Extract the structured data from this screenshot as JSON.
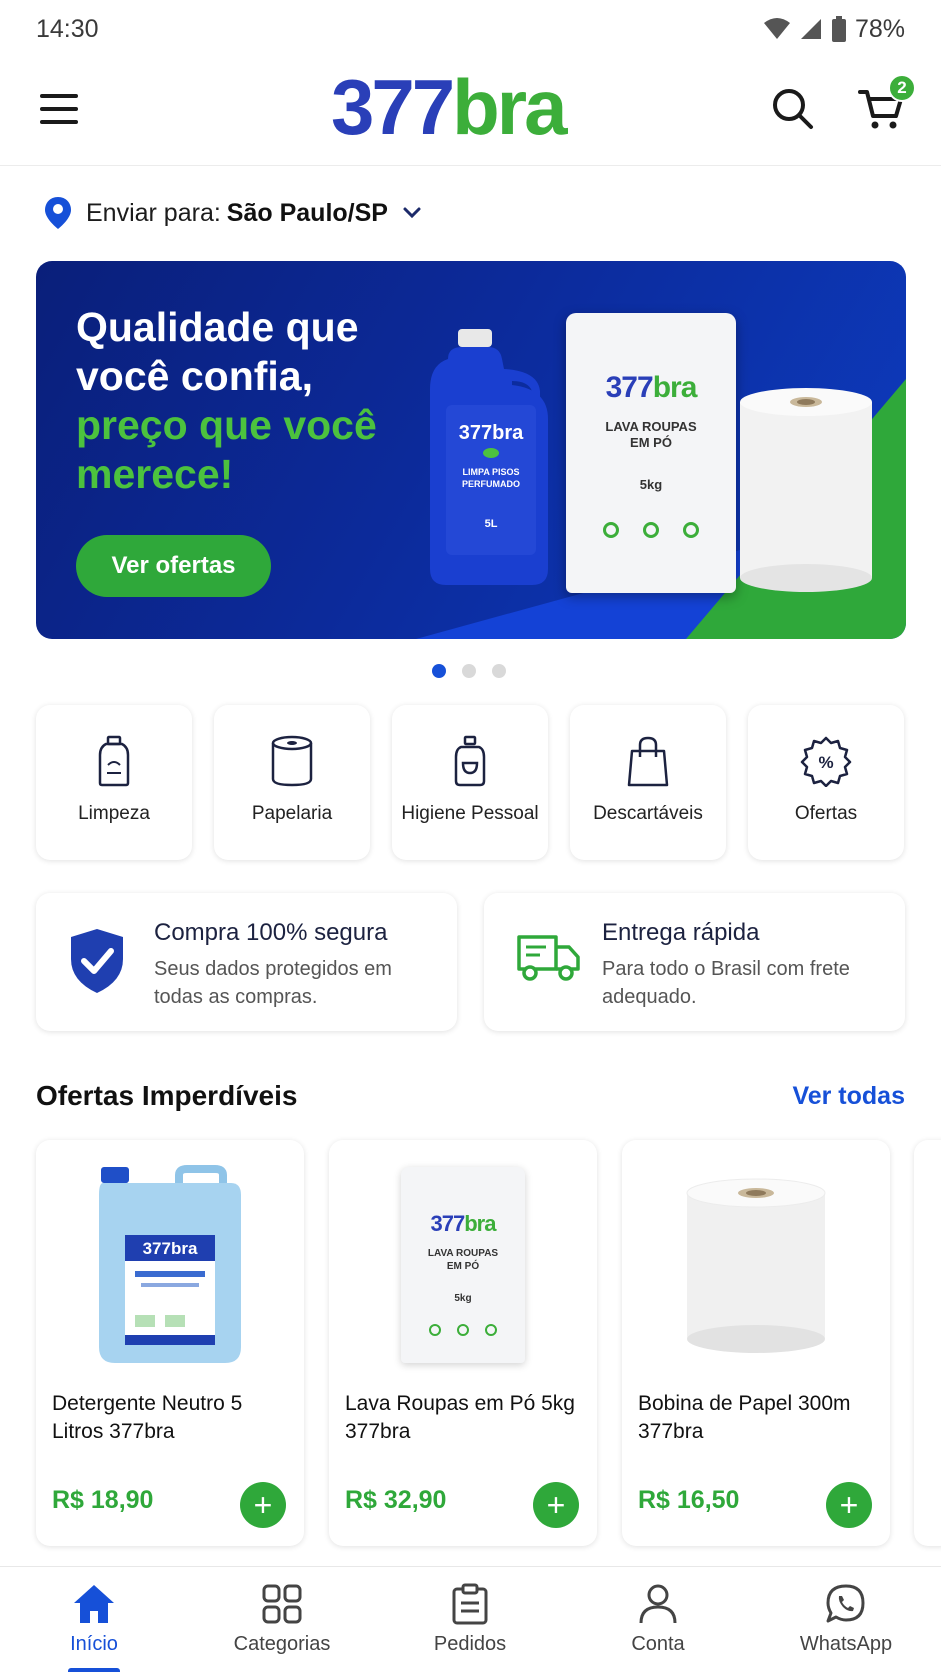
{
  "status_bar": {
    "time": "14:30",
    "battery": "78%"
  },
  "header": {
    "logo_number": "377",
    "logo_text": "bra",
    "cart_count": "2"
  },
  "ship_to": {
    "label": "Enviar para:",
    "city": "São Paulo/SP"
  },
  "hero": {
    "line1": "Qualidade que",
    "line2": "você confia,",
    "line3": "preço que você",
    "line4": "merece!",
    "cta": "Ver ofertas",
    "bottle_logo": "377bra",
    "bottle_text": "LIMPA PISOS PERFUMADO",
    "bottle_volume": "5L",
    "bag_logo_number": "377",
    "bag_logo_text": "bra",
    "bag_line1": "LAVA ROUPAS",
    "bag_line2": "EM PÓ",
    "bag_weight": "5kg",
    "slides_total": 3,
    "active_slide": 1
  },
  "categories": [
    {
      "label": "Limpeza",
      "icon": "bottle-icon"
    },
    {
      "label": "Papelaria",
      "icon": "paper-roll-icon"
    },
    {
      "label": "Higiene Pessoal",
      "icon": "soap-dispenser-icon"
    },
    {
      "label": "Descartáveis",
      "icon": "shopping-bag-icon"
    },
    {
      "label": "Ofertas",
      "icon": "discount-badge-icon"
    }
  ],
  "info": [
    {
      "title": "Compra 100% segura",
      "subtitle": "Seus dados protegidos em todas as compras.",
      "icon": "shield-check-icon"
    },
    {
      "title": "Entrega rápida",
      "subtitle": "Para todo o Brasil com frete adequado.",
      "icon": "delivery-truck-icon"
    }
  ],
  "offers": {
    "title": "Ofertas Imperdíveis",
    "see_all": "Ver todas",
    "products": [
      {
        "name": "Detergente Neutro 5 Litros 377bra",
        "price": "R$ 18,90",
        "add": "+"
      },
      {
        "name": "Lava Roupas em Pó 5kg 377bra",
        "price": "R$ 32,90",
        "add": "+"
      },
      {
        "name": "Bobina de Papel 300m 377bra",
        "price": "R$ 16,50",
        "add": "+"
      }
    ]
  },
  "bottom_nav": [
    {
      "label": "Início",
      "icon": "home-icon",
      "active": true
    },
    {
      "label": "Categorias",
      "icon": "grid-icon",
      "active": false
    },
    {
      "label": "Pedidos",
      "icon": "clipboard-icon",
      "active": false
    },
    {
      "label": "Conta",
      "icon": "user-icon",
      "active": false
    },
    {
      "label": "WhatsApp",
      "icon": "whatsapp-icon",
      "active": false
    }
  ],
  "colors": {
    "brand_blue": "#2a3fb8",
    "brand_green": "#3cae3a",
    "accent_blue": "#1650d8",
    "price_green": "#2fa83a"
  }
}
